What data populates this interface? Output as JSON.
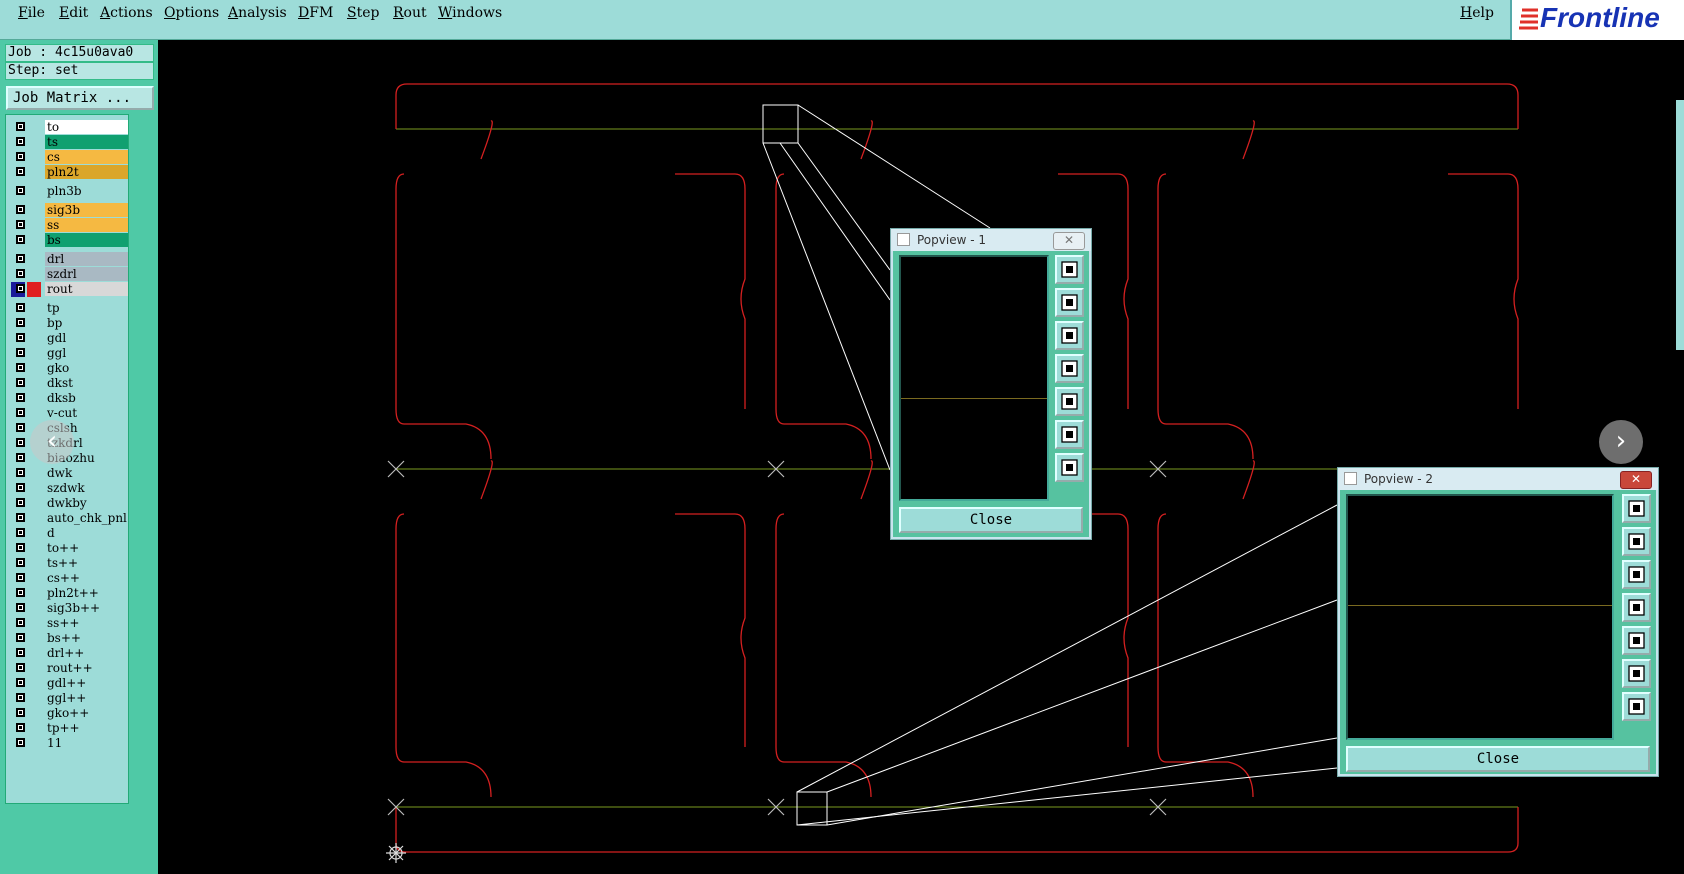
{
  "menubar": {
    "items": [
      "File",
      "Edit",
      "Actions",
      "Options",
      "Analysis",
      "DFM",
      "Step",
      "Rout",
      "Windows"
    ],
    "help": "Help",
    "logo": "Frontline"
  },
  "job": {
    "job_line": "Job : 4c15u0ava0",
    "step_line": "Step: set",
    "job_matrix_button": "Job Matrix ..."
  },
  "layers": [
    {
      "name": "to",
      "color": "#ffffff"
    },
    {
      "name": "ts",
      "color": "#10a070"
    },
    {
      "name": "cs",
      "color": "#f5b942"
    },
    {
      "name": "pln2t",
      "color": "#dba62a"
    },
    {
      "name": "pln3b",
      "color": "#9ddcd8"
    },
    {
      "name": "sig3b",
      "color": "#f5b942"
    },
    {
      "name": "ss",
      "color": "#f5b942"
    },
    {
      "name": "bs",
      "color": "#10a070"
    },
    {
      "name": "drl",
      "color": "#a9b9c3"
    },
    {
      "name": "szdrl",
      "color": "#a9b9c3"
    },
    {
      "name": "rout",
      "color": "#d8d8d8"
    },
    {
      "name": "tp",
      "color": "#9ddcd8"
    },
    {
      "name": "bp",
      "color": "#9ddcd8"
    },
    {
      "name": "gdl",
      "color": "#9ddcd8"
    },
    {
      "name": "ggl",
      "color": "#9ddcd8"
    },
    {
      "name": "gko",
      "color": "#9ddcd8"
    },
    {
      "name": "dkst",
      "color": "#9ddcd8"
    },
    {
      "name": "dksb",
      "color": "#9ddcd8"
    },
    {
      "name": "v-cut",
      "color": "#9ddcd8"
    },
    {
      "name": "cslsh",
      "color": "#9ddcd8"
    },
    {
      "name": "tzkdrl",
      "color": "#9ddcd8"
    },
    {
      "name": "biaozhu",
      "color": "#9ddcd8"
    },
    {
      "name": "dwk",
      "color": "#9ddcd8"
    },
    {
      "name": "szdwk",
      "color": "#9ddcd8"
    },
    {
      "name": "dwkby",
      "color": "#9ddcd8"
    },
    {
      "name": "auto_chk_pnl",
      "color": "#9ddcd8"
    },
    {
      "name": "d",
      "color": "#9ddcd8"
    },
    {
      "name": "to++",
      "color": "#9ddcd8"
    },
    {
      "name": "ts++",
      "color": "#9ddcd8"
    },
    {
      "name": "cs++",
      "color": "#9ddcd8"
    },
    {
      "name": "pln2t++",
      "color": "#9ddcd8"
    },
    {
      "name": "sig3b++",
      "color": "#9ddcd8"
    },
    {
      "name": "ss++",
      "color": "#9ddcd8"
    },
    {
      "name": "bs++",
      "color": "#9ddcd8"
    },
    {
      "name": "drl++",
      "color": "#9ddcd8"
    },
    {
      "name": "rout++",
      "color": "#9ddcd8"
    },
    {
      "name": "gdl++",
      "color": "#9ddcd8"
    },
    {
      "name": "ggl++",
      "color": "#9ddcd8"
    },
    {
      "name": "gko++",
      "color": "#9ddcd8"
    },
    {
      "name": "tp++",
      "color": "#9ddcd8"
    },
    {
      "name": "11",
      "color": "#9ddcd8"
    }
  ],
  "popview1": {
    "title": "Popview - 1",
    "close_label": "Close"
  },
  "popview2": {
    "title": "Popview - 2",
    "close_label": "Close"
  },
  "nav": {
    "prev": "‹",
    "next": "›"
  },
  "colors": {
    "rout_line": "#d42020",
    "score_line": "#7a9a20",
    "menubar": "#9ddcd8",
    "panel": "#4fc9a6"
  }
}
